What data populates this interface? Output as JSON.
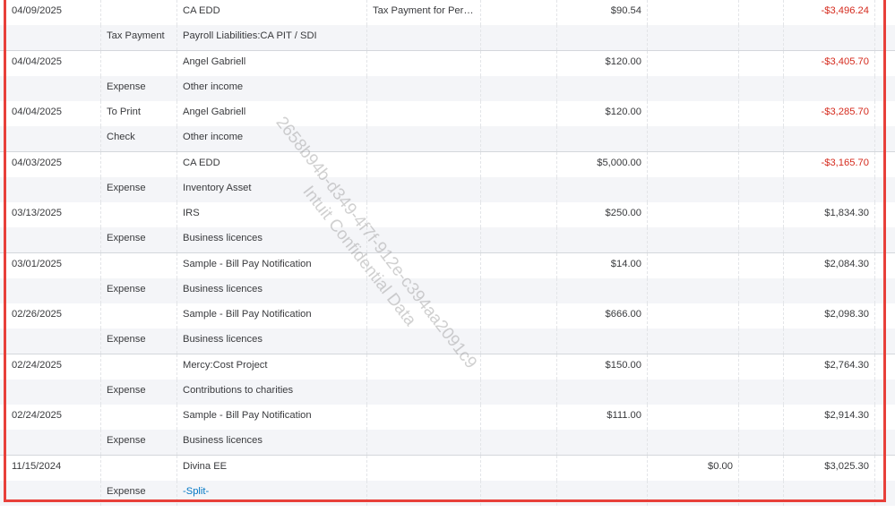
{
  "watermark": {
    "line1": "2658b94b-d349-4f7f-912e-c394aa2091c9",
    "line2": "Intuit Confidential Data"
  },
  "colors": {
    "negative_balance": "#d52b1e",
    "highlight_frame": "#e8403a",
    "split_link": "#0077c5"
  },
  "transactions": [
    {
      "date": "04/09/2025",
      "ref": "",
      "payee": "CA EDD",
      "memo": "Tax Payment for Peri…",
      "payment": "$90.54",
      "deposit": "",
      "balance": "-$3,496.24",
      "type": "Tax Payment",
      "account": "Payroll Liabilities:CA PIT / SDI"
    },
    {
      "date": "04/04/2025",
      "ref": "",
      "payee": "Angel Gabriell",
      "memo": "",
      "payment": "$120.00",
      "deposit": "",
      "balance": "-$3,405.70",
      "type": "Expense",
      "account": "Other income"
    },
    {
      "date": "04/04/2025",
      "ref": "To Print",
      "payee": "Angel Gabriell",
      "memo": "",
      "payment": "$120.00",
      "deposit": "",
      "balance": "-$3,285.70",
      "type": "Check",
      "account": "Other income"
    },
    {
      "date": "04/03/2025",
      "ref": "",
      "payee": "CA EDD",
      "memo": "",
      "payment": "$5,000.00",
      "deposit": "",
      "balance": "-$3,165.70",
      "type": "Expense",
      "account": "Inventory Asset"
    },
    {
      "date": "03/13/2025",
      "ref": "",
      "payee": "IRS",
      "memo": "",
      "payment": "$250.00",
      "deposit": "",
      "balance": "$1,834.30",
      "type": "Expense",
      "account": "Business licences"
    },
    {
      "date": "03/01/2025",
      "ref": "",
      "payee": "Sample - Bill Pay Notification",
      "memo": "",
      "payment": "$14.00",
      "deposit": "",
      "balance": "$2,084.30",
      "type": "Expense",
      "account": "Business licences"
    },
    {
      "date": "02/26/2025",
      "ref": "",
      "payee": "Sample - Bill Pay Notification",
      "memo": "",
      "payment": "$666.00",
      "deposit": "",
      "balance": "$2,098.30",
      "type": "Expense",
      "account": "Business licences"
    },
    {
      "date": "02/24/2025",
      "ref": "",
      "payee": "Mercy:Cost Project",
      "memo": "",
      "payment": "$150.00",
      "deposit": "",
      "balance": "$2,764.30",
      "type": "Expense",
      "account": "Contributions to charities"
    },
    {
      "date": "02/24/2025",
      "ref": "",
      "payee": "Sample - Bill Pay Notification",
      "memo": "",
      "payment": "$111.00",
      "deposit": "",
      "balance": "$2,914.30",
      "type": "Expense",
      "account": "Business licences"
    },
    {
      "date": "11/15/2024",
      "ref": "",
      "payee": "Divina EE",
      "memo": "",
      "payment": "",
      "deposit": "$0.00",
      "balance": "$3,025.30",
      "type": "Expense",
      "account": "-Split-"
    }
  ]
}
